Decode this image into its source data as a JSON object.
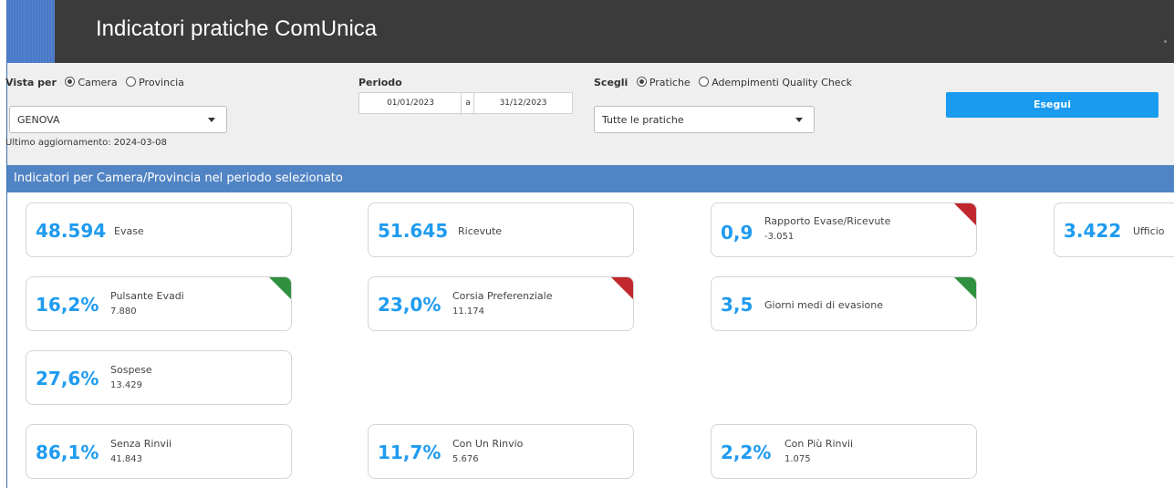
{
  "header": {
    "title": "Indicatori pratiche ComUnica"
  },
  "filters": {
    "vista_label": "Vista per",
    "vista_options": [
      "Camera",
      "Provincia"
    ],
    "vista_selected": "Camera",
    "camera_select_value": "GENOVA",
    "last_update": "Ultimo aggiornamento: 2024-03-08",
    "periodo_label": "Periodo",
    "date_from": "01/01/2023",
    "date_sep": "a",
    "date_to": "31/12/2023",
    "scegli_label": "Scegli",
    "scegli_options": [
      "Pratiche",
      "Adempimenti Quality Check"
    ],
    "scegli_selected": "Pratiche",
    "pratiche_select_value": "Tutte le pratiche",
    "execute_label": "Esegui"
  },
  "section": {
    "title": "Indicatori per Camera/Provincia nel periodo selezionato"
  },
  "cards": [
    {
      "value": "48.594",
      "label": "Evase",
      "sub": "",
      "flag": ""
    },
    {
      "value": "51.645",
      "label": "Ricevute",
      "sub": "",
      "flag": ""
    },
    {
      "value": "0,9",
      "label": "Rapporto Evase/Ricevute",
      "sub": "-3.051",
      "flag": "red"
    },
    {
      "value": "3.422",
      "label": "Ufficio",
      "sub": "",
      "flag": ""
    },
    {
      "value": "16,2%",
      "label": "Pulsante Evadi",
      "sub": "7.880",
      "flag": "green"
    },
    {
      "value": "23,0%",
      "label": "Corsia Preferenziale",
      "sub": "11.174",
      "flag": "red"
    },
    {
      "value": "3,5",
      "label": "Giorni medi di evasione",
      "sub": "",
      "flag": "green"
    },
    {
      "value": "27,6%",
      "label": "Sospese",
      "sub": "13.429",
      "flag": ""
    },
    {
      "value": "86,1%",
      "label": "Senza Rinvii",
      "sub": "41.843",
      "flag": ""
    },
    {
      "value": "11,7%",
      "label": "Con Un Rinvio",
      "sub": "5.676",
      "flag": ""
    },
    {
      "value": "2,2%",
      "label": "Con Più Rinvii",
      "sub": "1.075",
      "flag": ""
    }
  ],
  "colors": {
    "accent_blue": "#1f9bf0",
    "section_blue": "#5184c4",
    "flag_red": "#c0282d",
    "flag_green": "#2f9140"
  }
}
